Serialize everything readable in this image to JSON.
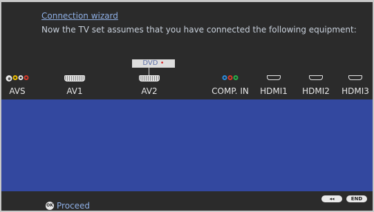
{
  "wizard": {
    "title": "Connection wizard",
    "message": "Now the TV set assumes that you have connected the following equipment:"
  },
  "assignment": {
    "device": "DVD",
    "dot": "•",
    "port": "AV2"
  },
  "ports": [
    {
      "label": "AVS",
      "icon": "avs-connector-icon"
    },
    {
      "label": "AV1",
      "icon": "scart-icon"
    },
    {
      "label": "AV2",
      "icon": "scart-icon"
    },
    {
      "label": "COMP. IN",
      "icon": "component-rca-icon"
    },
    {
      "label": "HDMI1",
      "icon": "hdmi-icon"
    },
    {
      "label": "HDMI2",
      "icon": "hdmi-icon"
    },
    {
      "label": "HDMI3",
      "icon": "hdmi-icon"
    }
  ],
  "footer": {
    "proceed_icon": "OK",
    "proceed_label": "Proceed",
    "back_label": "◂◂",
    "end_label": "END"
  },
  "colors": {
    "background": "#2b2b2b",
    "panel": "#33489f",
    "link_text": "#8fb0e6",
    "assign_dot": "#d8262a"
  }
}
